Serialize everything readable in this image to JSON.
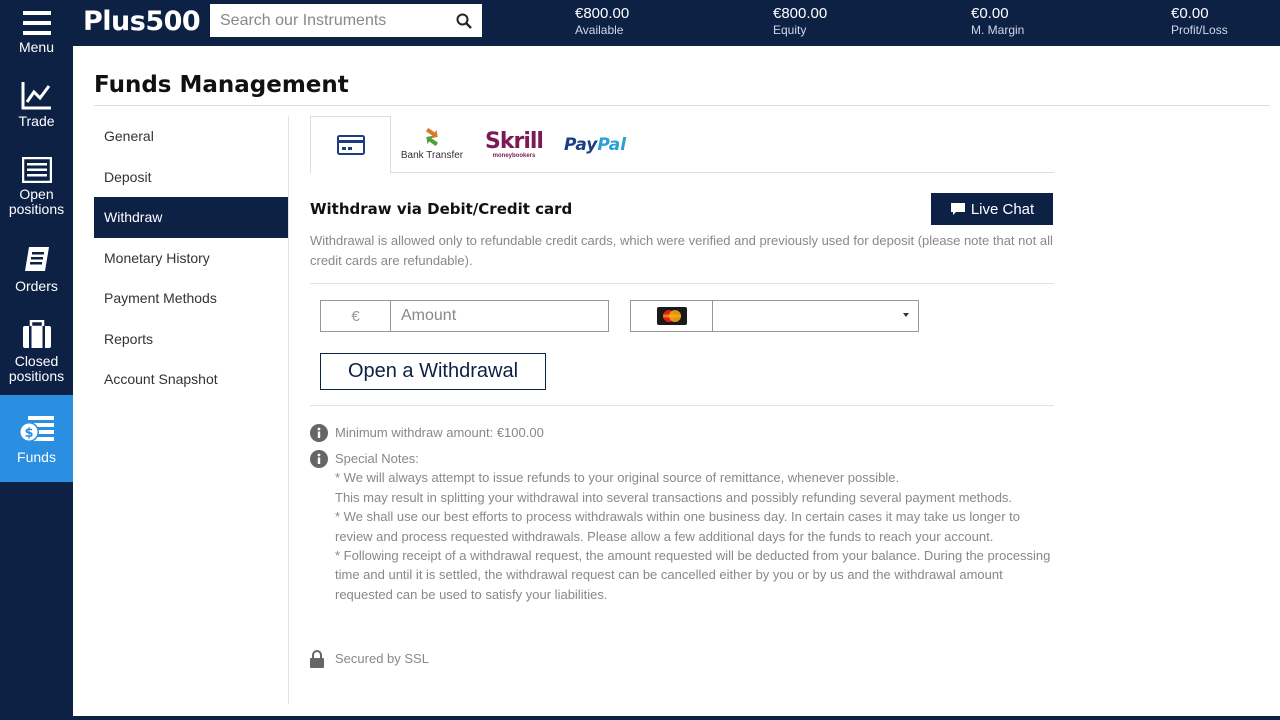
{
  "rail": {
    "menu": "Menu",
    "trade": "Trade",
    "open_positions": "Open positions",
    "orders": "Orders",
    "closed_positions": "Closed positions",
    "funds": "Funds"
  },
  "topbar": {
    "logo_text": "Plus500",
    "search_placeholder": "Search our Instruments",
    "stats": [
      {
        "value": "€800.00",
        "label": "Available"
      },
      {
        "value": "€800.00",
        "label": "Equity"
      },
      {
        "value": "€0.00",
        "label": "M. Margin"
      },
      {
        "value": "€0.00",
        "label": "Profit/Loss"
      }
    ]
  },
  "page": {
    "title": "Funds Management"
  },
  "sidenav": {
    "items": [
      "General",
      "Deposit",
      "Withdraw",
      "Monetary History",
      "Payment Methods",
      "Reports",
      "Account Snapshot"
    ],
    "active_index": 2
  },
  "methods": {
    "bank_transfer": "Bank Transfer",
    "skrill": "Skrill",
    "skrill_sub": "moneybookers",
    "paypal_pay": "Pay",
    "paypal_pal": "Pal"
  },
  "withdraw": {
    "title": "Withdraw via Debit/Credit card",
    "live_chat": "Live Chat",
    "notice": "Withdrawal is allowed only to refundable credit cards, which were verified and previously used for deposit (please note that not all credit cards are refundable).",
    "currency_symbol": "€",
    "amount_placeholder": "Amount",
    "amount_value": "",
    "card_selected": "",
    "open_button": "Open a Withdrawal",
    "min_amount": "Minimum withdraw amount: €100.00",
    "special_notes_title": "Special Notes:",
    "notes": [
      "* We will always attempt to issue refunds to your original source of remittance, whenever possible.",
      "This may result in splitting your withdrawal into several transactions and possibly refunding several payment methods.",
      "* We shall use our best efforts to process withdrawals within one business day. In certain cases it may take us longer to review and process requested withdrawals. Please allow a few additional days for the funds to reach your account.",
      "* Following receipt of a withdrawal request, the amount requested will be deducted from your balance. During the processing time and until it is settled, the withdrawal request can be cancelled either by you or by us and the withdrawal amount requested can be used to satisfy your liabilities."
    ],
    "ssl": "Secured by SSL"
  },
  "colors": {
    "navy": "#0d2145",
    "active_blue": "#2a8fe0",
    "skrill_purple": "#7b1a54",
    "paypal_dark": "#1d3c86",
    "paypal_light": "#2a9fd8"
  }
}
